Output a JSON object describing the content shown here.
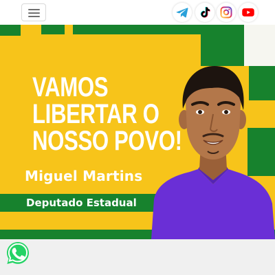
{
  "header": {
    "menu_icon": "hamburger-menu-icon",
    "social_links": [
      {
        "name": "telegram",
        "icon": "telegram-icon",
        "color": "#2aa1da"
      },
      {
        "name": "tiktok",
        "icon": "tiktok-icon",
        "color": "#000000"
      },
      {
        "name": "instagram",
        "icon": "instagram-icon",
        "color": "#d6249f"
      },
      {
        "name": "youtube",
        "icon": "youtube-icon",
        "color": "#ff0000"
      }
    ]
  },
  "banner": {
    "headline": [
      "VAMOS",
      "LIBERTAR O",
      "NOSSO POVO!"
    ],
    "candidate_name": "Miguel Martins",
    "role": "Deputado Estadual",
    "colors": {
      "yellow": "#f7c41a",
      "green": "#17822d",
      "shirt": "#6a2fd6"
    }
  },
  "footer": {
    "whatsapp_icon": "whatsapp-icon",
    "whatsapp_color": "#25d366"
  }
}
